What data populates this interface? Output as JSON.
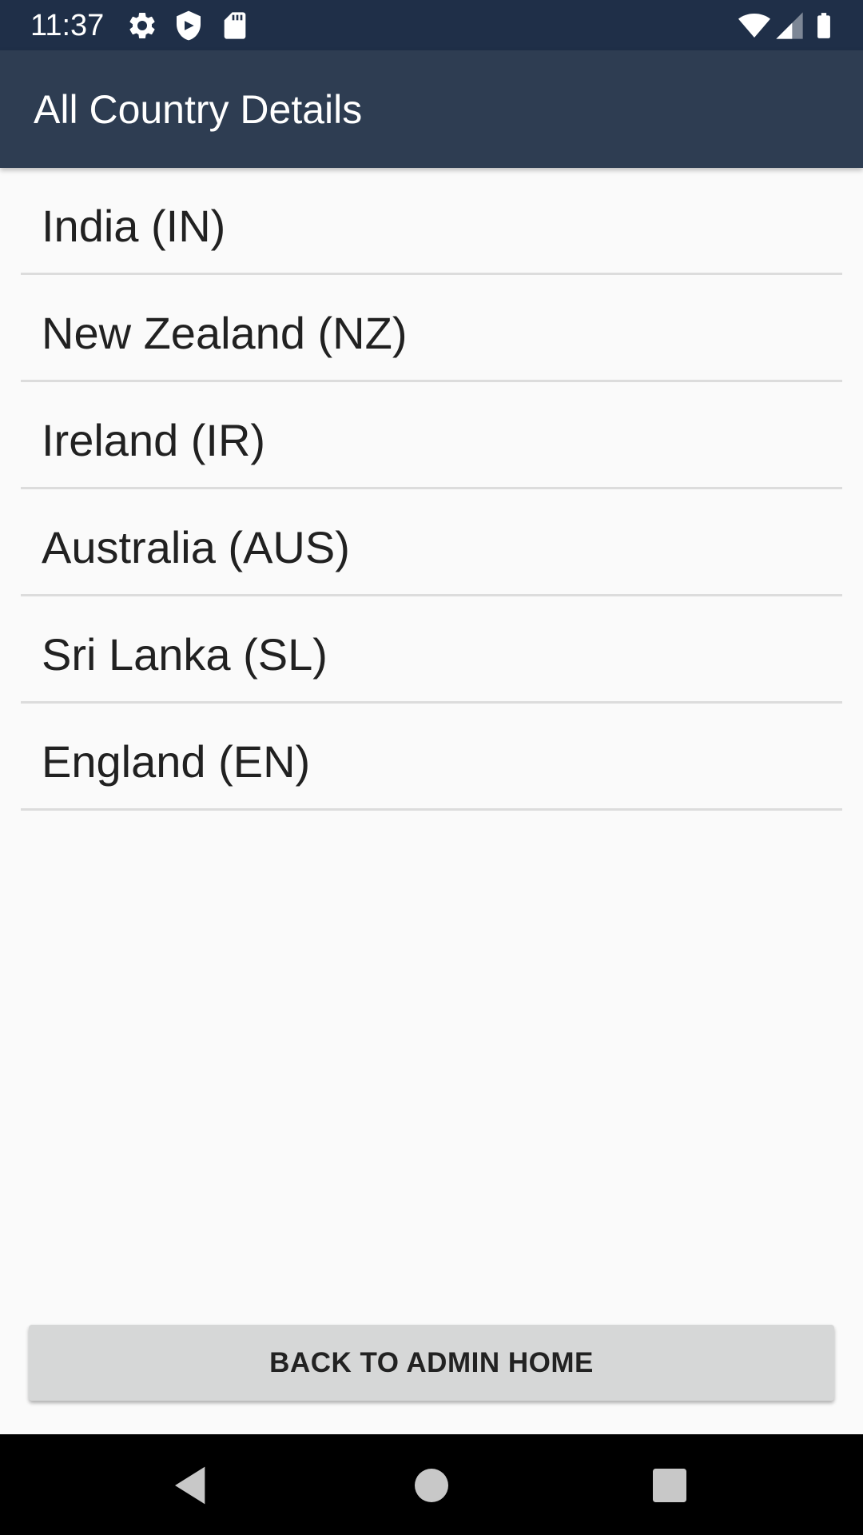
{
  "status_bar": {
    "time": "11:37",
    "icons_left": [
      "gear-icon",
      "shield-icon",
      "sd-card-icon"
    ],
    "icons_right": [
      "wifi-icon",
      "signal-icon",
      "battery-icon"
    ]
  },
  "app_bar": {
    "title": "All Country Details"
  },
  "countries": [
    {
      "label": "India (IN)"
    },
    {
      "label": "New Zealand (NZ)"
    },
    {
      "label": "Ireland (IR)"
    },
    {
      "label": "Australia (AUS)"
    },
    {
      "label": "Sri Lanka (SL)"
    },
    {
      "label": "England (EN)"
    }
  ],
  "back_button": {
    "label": "BACK TO ADMIN HOME"
  },
  "nav_bar": {
    "buttons": [
      "back-icon",
      "home-icon",
      "recents-icon"
    ]
  },
  "colors": {
    "status_bar": "#1f2f48",
    "app_bar": "#2e3d52",
    "background": "#fafafa",
    "button": "#d6d7d7",
    "divider": "#dcdcdc"
  }
}
